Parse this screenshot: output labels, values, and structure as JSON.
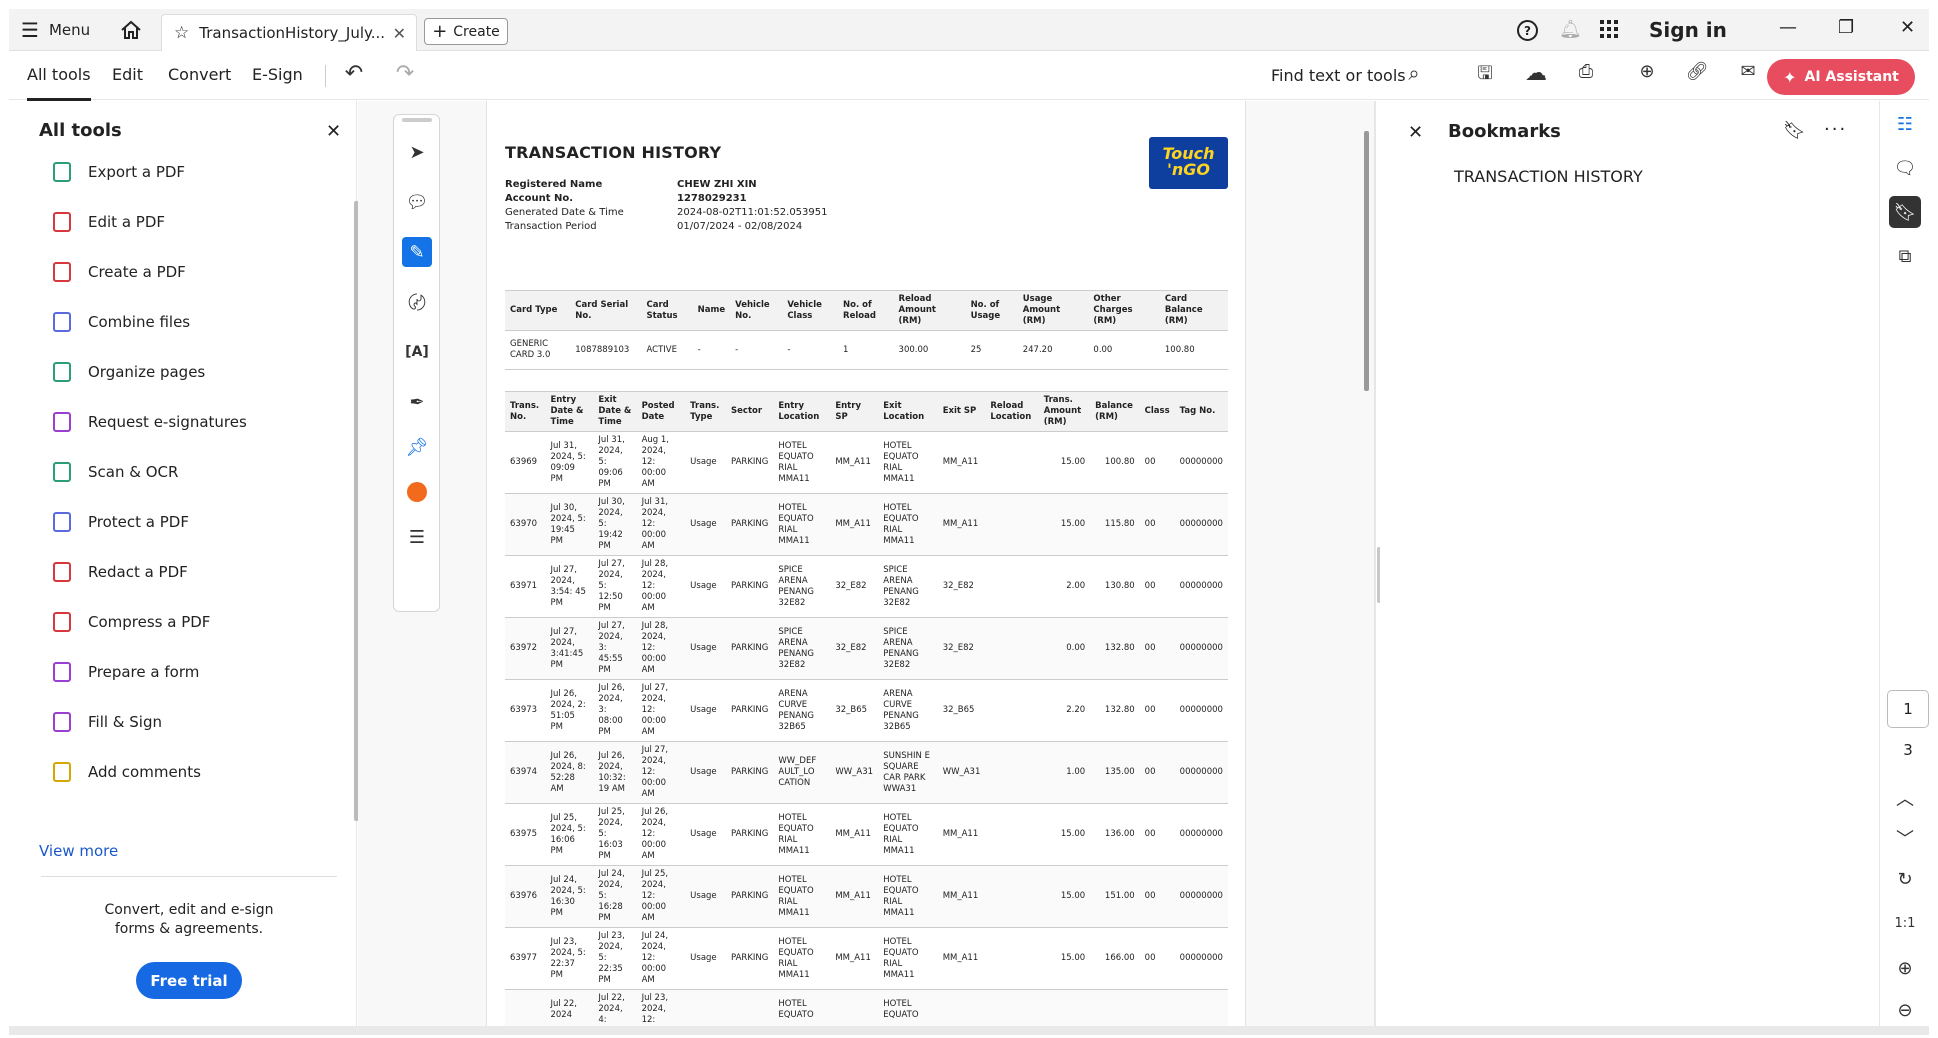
{
  "titlebar": {
    "menu_label": "Menu",
    "tab_title": "TransactionHistory_July...",
    "create_label": "Create",
    "sign_in": "Sign in"
  },
  "toolbar": {
    "tabs": [
      "All tools",
      "Edit",
      "Convert",
      "E-Sign"
    ],
    "find_label": "Find text or tools",
    "ai_label": "AI Assistant"
  },
  "left_panel": {
    "title": "All tools",
    "items": [
      {
        "label": "Export a PDF",
        "icon": "export-pdf-icon",
        "color": "#2d9d78"
      },
      {
        "label": "Edit a PDF",
        "icon": "edit-pdf-icon",
        "color": "#d7373f"
      },
      {
        "label": "Create a PDF",
        "icon": "create-pdf-icon",
        "color": "#d7373f"
      },
      {
        "label": "Combine files",
        "icon": "combine-files-icon",
        "color": "#5b6ae0"
      },
      {
        "label": "Organize pages",
        "icon": "organize-pages-icon",
        "color": "#2d9d78"
      },
      {
        "label": "Request e-signatures",
        "icon": "request-signatures-icon",
        "color": "#9b3fcf"
      },
      {
        "label": "Scan & OCR",
        "icon": "scan-ocr-icon",
        "color": "#2d9d78"
      },
      {
        "label": "Protect a PDF",
        "icon": "protect-pdf-icon",
        "color": "#5b6ae0"
      },
      {
        "label": "Redact a PDF",
        "icon": "redact-pdf-icon",
        "color": "#d7373f"
      },
      {
        "label": "Compress a PDF",
        "icon": "compress-pdf-icon",
        "color": "#d7373f"
      },
      {
        "label": "Prepare a form",
        "icon": "prepare-form-icon",
        "color": "#9b3fcf"
      },
      {
        "label": "Fill & Sign",
        "icon": "fill-sign-icon",
        "color": "#9b3fcf"
      },
      {
        "label": "Add comments",
        "icon": "add-comments-icon",
        "color": "#d4a800"
      }
    ],
    "view_more": "View more",
    "promo_line1": "Convert, edit and e-sign",
    "promo_line2": "forms & agreements.",
    "free_trial": "Free trial"
  },
  "document": {
    "title": "TRANSACTION HISTORY",
    "logo_line1": "Touch",
    "logo_line2": "'nGO",
    "meta": [
      {
        "key": "Registered Name",
        "value": "CHEW ZHI XIN",
        "bold": true
      },
      {
        "key": "Account No.",
        "value": "1278029231",
        "bold": true
      },
      {
        "key": "Generated Date & Time",
        "value": "2024-08-02T11:01:52.053951",
        "bold": false
      },
      {
        "key": "Transaction Period",
        "value": "01/07/2024 - 02/08/2024",
        "bold": false
      }
    ],
    "card_headers": [
      "Card Type",
      "Card Serial No.",
      "Card Status",
      "Name",
      "Vehicle No.",
      "Vehicle Class",
      "No. of Reload",
      "Reload Amount (RM)",
      "No. of Usage",
      "Usage Amount (RM)",
      "Other Charges (RM)",
      "Card Balance (RM)"
    ],
    "card_row": [
      "GENERIC CARD 3.0",
      "1087889103",
      "ACTIVE",
      "-",
      "-",
      "-",
      "1",
      "300.00",
      "25",
      "247.20",
      "0.00",
      "100.80"
    ],
    "tx_headers": [
      "Trans. No.",
      "Entry Date & Time",
      "Exit Date & Time",
      "Posted Date",
      "Trans. Type",
      "Sector",
      "Entry Location",
      "Entry SP",
      "Exit Location",
      "Exit SP",
      "Reload Location",
      "Trans. Amount (RM)",
      "Balance (RM)",
      "Class",
      "Tag No."
    ],
    "tx_rows": [
      [
        "63969",
        "Jul 31, 2024, 5: 09:09 PM",
        "Jul 31, 2024, 5: 09:06 PM",
        "Aug 1, 2024, 12: 00:00 AM",
        "Usage",
        "PARKING",
        "HOTEL EQUATO RIAL MMA11",
        "MM_A11",
        "HOTEL EQUATO RIAL MMA11",
        "MM_A11",
        "",
        "15.00",
        "100.80",
        "00",
        "00000000"
      ],
      [
        "63970",
        "Jul 30, 2024, 5: 19:45 PM",
        "Jul 30, 2024, 5: 19:42 PM",
        "Jul 31, 2024, 12: 00:00 AM",
        "Usage",
        "PARKING",
        "HOTEL EQUATO RIAL MMA11",
        "MM_A11",
        "HOTEL EQUATO RIAL MMA11",
        "MM_A11",
        "",
        "15.00",
        "115.80",
        "00",
        "00000000"
      ],
      [
        "63971",
        "Jul 27, 2024, 3:54: 45 PM",
        "Jul 27, 2024, 5: 12:50 PM",
        "Jul 28, 2024, 12: 00:00 AM",
        "Usage",
        "PARKING",
        "SPICE ARENA PENANG 32E82",
        "32_E82",
        "SPICE ARENA PENANG 32E82",
        "32_E82",
        "",
        "2.00",
        "130.80",
        "00",
        "00000000"
      ],
      [
        "63972",
        "Jul 27, 2024, 3:41:45 PM",
        "Jul 27, 2024, 3: 45:55 PM",
        "Jul 28, 2024, 12: 00:00 AM",
        "Usage",
        "PARKING",
        "SPICE ARENA PENANG 32E82",
        "32_E82",
        "SPICE ARENA PENANG 32E82",
        "32_E82",
        "",
        "0.00",
        "132.80",
        "00",
        "00000000"
      ],
      [
        "63973",
        "Jul 26, 2024, 2: 51:05 PM",
        "Jul 26, 2024, 3: 08:00 PM",
        "Jul 27, 2024, 12: 00:00 AM",
        "Usage",
        "PARKING",
        "ARENA CURVE PENANG 32B65",
        "32_B65",
        "ARENA CURVE PENANG 32B65",
        "32_B65",
        "",
        "2.20",
        "132.80",
        "00",
        "00000000"
      ],
      [
        "63974",
        "Jul 26, 2024, 8: 52:28 AM",
        "Jul 26, 2024, 10:32: 19 AM",
        "Jul 27, 2024, 12: 00:00 AM",
        "Usage",
        "PARKING",
        "WW_DEF AULT_LO CATION",
        "WW_A31",
        "SUNSHIN E SQUARE CAR PARK WWA31",
        "WW_A31",
        "",
        "1.00",
        "135.00",
        "00",
        "00000000"
      ],
      [
        "63975",
        "Jul 25, 2024, 5: 16:06 PM",
        "Jul 25, 2024, 5: 16:03 PM",
        "Jul 26, 2024, 12: 00:00 AM",
        "Usage",
        "PARKING",
        "HOTEL EQUATO RIAL MMA11",
        "MM_A11",
        "HOTEL EQUATO RIAL MMA11",
        "MM_A11",
        "",
        "15.00",
        "136.00",
        "00",
        "00000000"
      ],
      [
        "63976",
        "Jul 24, 2024, 5: 16:30 PM",
        "Jul 24, 2024, 5: 16:28 PM",
        "Jul 25, 2024, 12: 00:00 AM",
        "Usage",
        "PARKING",
        "HOTEL EQUATO RIAL MMA11",
        "MM_A11",
        "HOTEL EQUATO RIAL MMA11",
        "MM_A11",
        "",
        "15.00",
        "151.00",
        "00",
        "00000000"
      ],
      [
        "63977",
        "Jul 23, 2024, 5: 22:37 PM",
        "Jul 23, 2024, 5: 22:35 PM",
        "Jul 24, 2024, 12: 00:00 AM",
        "Usage",
        "PARKING",
        "HOTEL EQUATO RIAL MMA11",
        "MM_A11",
        "HOTEL EQUATO RIAL MMA11",
        "MM_A11",
        "",
        "15.00",
        "166.00",
        "00",
        "00000000"
      ],
      [
        "",
        "Jul 22, 2024",
        "Jul 22, 2024, 4:",
        "Jul 23, 2024, 12:",
        "",
        "",
        "HOTEL EQUATO",
        "",
        "HOTEL EQUATO",
        "",
        "",
        "",
        "",
        "",
        ""
      ]
    ]
  },
  "bookmarks": {
    "title": "Bookmarks",
    "items": [
      "TRANSACTION HISTORY"
    ]
  },
  "page_nav": {
    "current": "1",
    "total": "3"
  },
  "colors": {
    "accent": "#1473e6",
    "ai_button": "#e74d5e",
    "free_trial": "#1668e3",
    "tng_blue": "#0f3f9e",
    "tng_yellow": "#ffd41f"
  }
}
